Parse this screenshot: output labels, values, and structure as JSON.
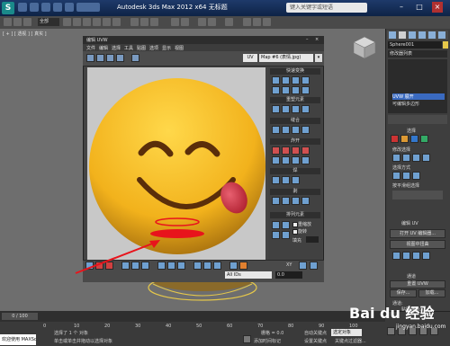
{
  "app": {
    "logo_text": "S",
    "title": "Autodesk 3ds Max 2012 x64    无标题",
    "search_placeholder": "键入关键字或短语"
  },
  "main_toolbar": {
    "selection_filter": "全部"
  },
  "viewport": {
    "label": "[ + ] [ 透视 ] [ 真实 ]"
  },
  "uvw_editor": {
    "title": "编辑 UVW",
    "menu": [
      "文件",
      "编辑",
      "选择",
      "工具",
      "贴图",
      "选项",
      "显示",
      "视图"
    ],
    "uv_dropdown": "UV",
    "map_selector": "Map #6 (表情.jpg)",
    "panels": {
      "quick_transform": "快速变换",
      "reshape": "重塑元素",
      "stitch": "缝合",
      "explode": "炸开",
      "weld": "焊",
      "peel": "剥",
      "arrange": "排列元素",
      "rescale": "重缩放",
      "rotate": "旋转",
      "padding": "填充"
    },
    "bottom": {
      "axis_label": "XY",
      "all_ids": "All IDs",
      "field_value": "0.0"
    }
  },
  "command_panel": {
    "object_name": "Sphere001",
    "modifier_list": "修改器列表",
    "stack": [
      "UVW 展开",
      "可编辑多边形"
    ],
    "labels": {
      "select": "选择",
      "modify_select": "修改选择",
      "select_by": "选择方式",
      "by_smoothing": "按平滑组选择",
      "edit_uvs": "编辑 UV",
      "open_uv_editor": "打开 UV 编辑器...",
      "tweak_in_view": "视图中扭曲",
      "channel": "通道",
      "reset_uvws": "重置 UVW",
      "save": "保存...",
      "load": "加载...",
      "channel_label": "通道:",
      "map_channel": "贴图通道:",
      "vertex_color": "顶点颜色通道"
    }
  },
  "status": {
    "frame_range": "0 / 100",
    "selected": "选择了 1 个 对象",
    "hint": "单击或单击并拖动以选择对象",
    "add_time_tag": "添加时间标记",
    "grid_label": "栅格 = 0.0",
    "auto_key": "自动关键点",
    "selected_dropdown": "选定对象",
    "set_key": "设置关键点",
    "key_filters": "关键点过滤器...",
    "welcome": "欢迎使用 MAXSc"
  },
  "ticks": [
    "0",
    "10",
    "20",
    "30",
    "40",
    "50",
    "60",
    "70",
    "80",
    "90",
    "100"
  ],
  "watermark": {
    "brand": "Bai du 经验",
    "url": "jingyan.baidu.com"
  },
  "colors": {
    "accent_red": "#e8141c",
    "face_yellow": "#f2b21c",
    "tongue_red": "#d63040"
  }
}
